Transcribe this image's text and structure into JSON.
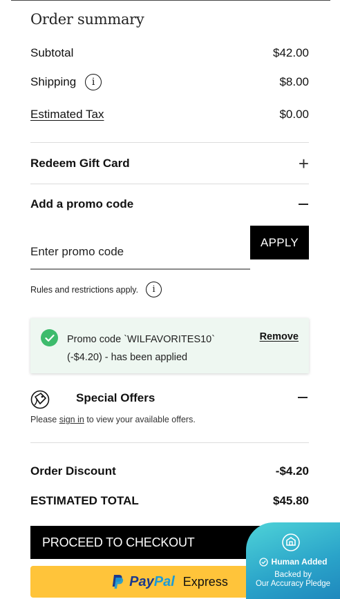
{
  "summary": {
    "title": "Order summary",
    "subtotal_label": "Subtotal",
    "subtotal_value": "$42.00",
    "shipping_label": "Shipping",
    "shipping_value": "$8.00",
    "tax_label": "Estimated Tax",
    "tax_value": "$0.00"
  },
  "gift_card": {
    "label": "Redeem Gift Card",
    "toggle": "+"
  },
  "promo": {
    "label": "Add a promo code",
    "placeholder": "Enter promo code",
    "apply_label": "APPLY",
    "rules_text": "Rules and restrictions apply.",
    "applied_line1": "Promo code `WILFAVORITES10`",
    "applied_line2": "(-$4.20) - has been applied",
    "remove_label": "Remove"
  },
  "offers": {
    "title": "Special Offers",
    "note_before": "Please ",
    "note_link": "sign in",
    "note_after": " to view your available offers."
  },
  "totals": {
    "discount_label": "Order Discount",
    "discount_value": "-$4.20",
    "total_label": "ESTIMATED TOTAL",
    "total_value": "$45.80"
  },
  "actions": {
    "checkout_label": "PROCEED TO CHECKOUT",
    "paypal_pay": "Pay",
    "paypal_pal": "Pal",
    "paypal_express": "Express"
  },
  "badge": {
    "line1": "Human Added",
    "line2a": "Backed by",
    "line2b": "Our Accuracy Pledge"
  },
  "colors": {
    "accent_green": "#3dbb6c",
    "paypal_yellow": "#ffc43a",
    "badge_teal": "#2aa3c9"
  },
  "icons": [
    "info-icon",
    "plus-icon",
    "minus-icon",
    "check-icon",
    "tag-icon",
    "paypal-logo",
    "badge-logo"
  ]
}
